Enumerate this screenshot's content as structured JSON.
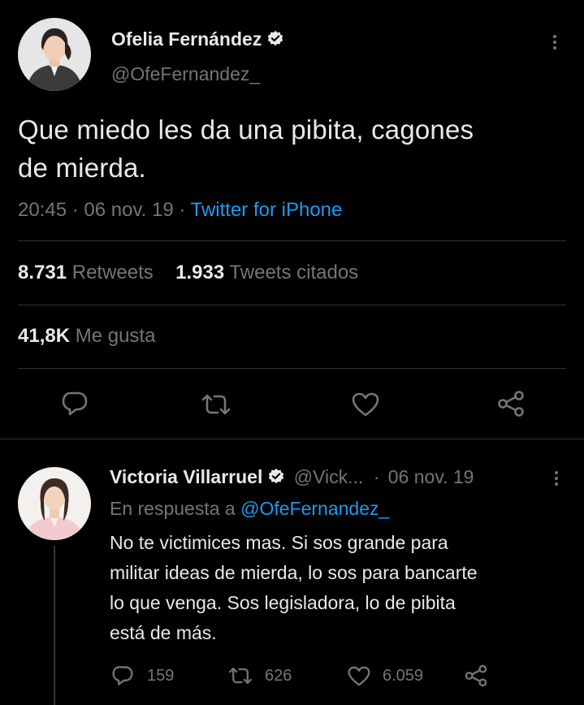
{
  "main_tweet": {
    "author_name": "Ofelia Fernández",
    "author_handle": "@OfeFernandez_",
    "text_line1": "Que miedo les da una pibita, cagones",
    "text_line2": "de mierda.",
    "time": "20:45",
    "separator": "·",
    "date": "06 nov. 19",
    "source": "Twitter for iPhone",
    "retweets_count": "8.731",
    "retweets_label": "Retweets",
    "quotes_count": "1.933",
    "quotes_label": "Tweets citados",
    "likes_count": "41,8K",
    "likes_label": "Me gusta"
  },
  "reply_tweet": {
    "author_name": "Victoria Villarruel",
    "author_handle": "@Vick...",
    "separator": "·",
    "date": "06 nov. 19",
    "reply_prefix": "En respuesta a",
    "reply_to": "@OfeFernandez_",
    "text_line1": "No te victimices mas. Si sos grande para",
    "text_line2": "militar ideas de mierda, lo sos para bancarte",
    "text_line3": "lo que venga. Sos legisladora, lo de pibita",
    "text_line4": "está de más.",
    "replies_count": "159",
    "retweets_count": "626",
    "likes_count": "6.059"
  },
  "colors": {
    "background": "#000000",
    "text": "#e7e9ea",
    "secondary": "#71767b",
    "link": "#1d9bf0",
    "divider": "#2f3336"
  }
}
